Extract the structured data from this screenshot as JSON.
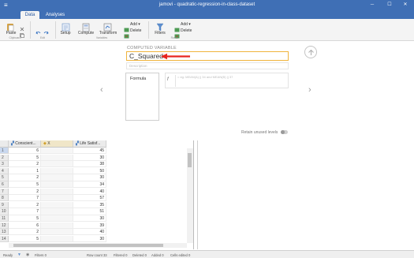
{
  "titlebar": {
    "menu_icon": "hamburger-icon",
    "title": "jamovi - quadratic-regression-in-class-dataset",
    "minimize": "─",
    "maximize": "☐",
    "close": "✕",
    "bg_color": "#3f6fb5"
  },
  "tabs": [
    {
      "label": "Data",
      "active": true
    },
    {
      "label": "Analyses",
      "active": false
    }
  ],
  "ribbon": {
    "paste": "Paste",
    "clipboard_group": "Clipboard",
    "edit_group": "Edit",
    "setup": "Setup",
    "compute": "Compute",
    "transform": "Transform",
    "add1": "Add ▾",
    "delete1": "Delete",
    "variables_group": "Variables",
    "filters": "Filters",
    "add2": "Add ▾",
    "delete2": "Delete",
    "rows_group": "Rows"
  },
  "setup": {
    "heading": "COMPUTED VARIABLE",
    "name_value": "C_Squared",
    "description_placeholder": "Description",
    "formula_label": "Formula",
    "fx_symbol": "f",
    "fx_placeholder": "= eg: MEAN(A) || 34 and MEAN(B) || 37",
    "retain_label": "Retain unused levels",
    "arrow_color": "#e8261f"
  },
  "grid": {
    "columns": [
      "Conscient...",
      "X",
      "Life Satisf..."
    ],
    "rows": [
      {
        "n": "1",
        "a": "6",
        "c": "45"
      },
      {
        "n": "2",
        "a": "5",
        "c": "30"
      },
      {
        "n": "3",
        "a": "2",
        "c": "38"
      },
      {
        "n": "4",
        "a": "1",
        "c": "50"
      },
      {
        "n": "5",
        "a": "2",
        "c": "30"
      },
      {
        "n": "6",
        "a": "5",
        "c": "34"
      },
      {
        "n": "7",
        "a": "2",
        "c": "40"
      },
      {
        "n": "8",
        "a": "7",
        "c": "57"
      },
      {
        "n": "9",
        "a": "2",
        "c": "35"
      },
      {
        "n": "10",
        "a": "7",
        "c": "51"
      },
      {
        "n": "11",
        "a": "5",
        "c": "30"
      },
      {
        "n": "12",
        "a": "6",
        "c": "39"
      },
      {
        "n": "13",
        "a": "2",
        "c": "40"
      },
      {
        "n": "14",
        "a": "5",
        "c": "30"
      }
    ]
  },
  "status": {
    "ready": "Ready",
    "filters": "Filters 0",
    "row_count": "Row count 33",
    "filtered": "Filtered 0",
    "deleted": "Deleted 0",
    "added": "Added 0",
    "cells_edited": "Cells edited 0"
  }
}
